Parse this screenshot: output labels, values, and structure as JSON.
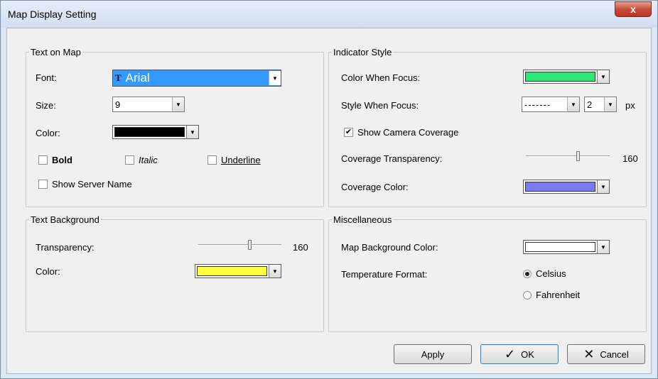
{
  "window": {
    "title": "Map Display Setting",
    "close_label": "x"
  },
  "text_on_map": {
    "legend": "Text on Map",
    "font_label": "Font:",
    "font_icon": "T",
    "font_value": "Arial",
    "size_label": "Size:",
    "size_value": "9",
    "color_label": "Color:",
    "color": "#000000",
    "bold_label": "Bold",
    "bold_checked": false,
    "italic_label": "Italic",
    "italic_checked": false,
    "underline_label": "Underline",
    "underline_checked": false,
    "show_server_label": "Show Server Name",
    "show_server_checked": false
  },
  "text_background": {
    "legend": "Text Background",
    "transparency_label": "Transparency:",
    "transparency_value": "160",
    "transparency_fraction": 0.63,
    "color_label": "Color:",
    "color": "#ffff3c"
  },
  "indicator_style": {
    "legend": "Indicator Style",
    "color_focus_label": "Color When Focus:",
    "color_focus": "#2ee87a",
    "style_focus_label": "Style When Focus:",
    "line_style_value": "-------",
    "width_value": "2",
    "width_unit": "px",
    "show_coverage_label": "Show Camera Coverage",
    "show_coverage_checked": true,
    "coverage_transparency_label": "Coverage Transparency:",
    "coverage_transparency_value": "160",
    "coverage_transparency_fraction": 0.63,
    "coverage_color_label": "Coverage Color:",
    "coverage_color": "#7b7bf5"
  },
  "misc": {
    "legend": "Miscellaneous",
    "map_bg_label": "Map Background Color:",
    "map_bg_color": "#ffffff",
    "temp_label": "Temperature Format:",
    "celsius_label": "Celsius",
    "fahrenheit_label": "Fahrenheit",
    "selected": "celsius"
  },
  "buttons": {
    "apply": "Apply",
    "ok": "OK",
    "ok_icon": "✓",
    "cancel": "Cancel",
    "cancel_icon": "✕"
  }
}
